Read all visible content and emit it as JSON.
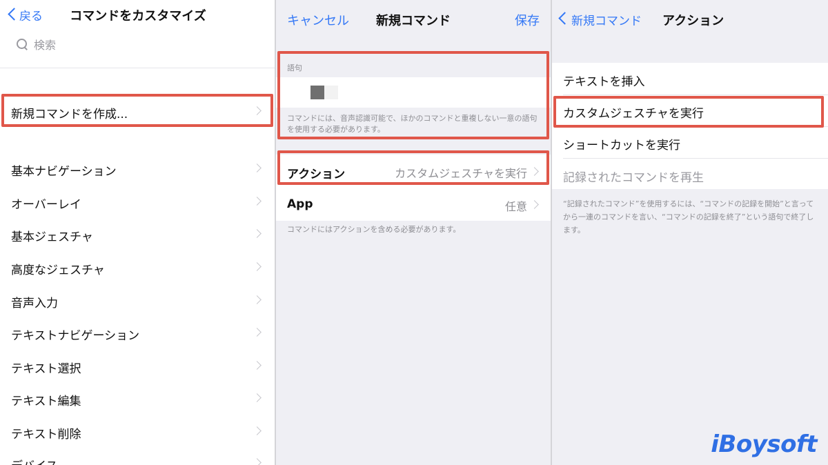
{
  "panel1": {
    "back_label": "戻る",
    "title": "コマンドをカスタマイズ",
    "search_placeholder": "検索",
    "new_command": "新規コマンドを作成...",
    "items": [
      "基本ナビゲーション",
      "オーバーレイ",
      "基本ジェスチャ",
      "高度なジェスチャ",
      "音声入力",
      "テキストナビゲーション",
      "テキスト選択",
      "テキスト編集",
      "テキスト削除",
      "デバイス"
    ]
  },
  "panel2": {
    "cancel_label": "キャンセル",
    "title": "新規コマンド",
    "save_label": "保存",
    "phrase_header": "語句",
    "phrase_footer": "コマンドには、音声認識可能で、ほかのコマンドと重複しない一意の語句を使用する必要があります。",
    "action_label": "アクション",
    "action_value": "カスタムジェスチャを実行",
    "app_label": "App",
    "app_value": "任意",
    "action_footer": "コマンドにはアクションを含める必要があります。"
  },
  "panel3": {
    "back_label": "新規コマンド",
    "title": "アクション",
    "items": [
      "テキストを挿入",
      "カスタムジェスチャを実行",
      "ショートカットを実行",
      "記録されたコマンドを再生"
    ],
    "footer": "“記録されたコマンド”を使用するには、“コマンドの記録を開始”と言ってから一連のコマンドを言い、“コマンドの記録を終了”という語句で終了します。"
  },
  "watermark": "iBoysoft",
  "colors": {
    "accent": "#3478f6",
    "highlight": "#e0574a"
  }
}
